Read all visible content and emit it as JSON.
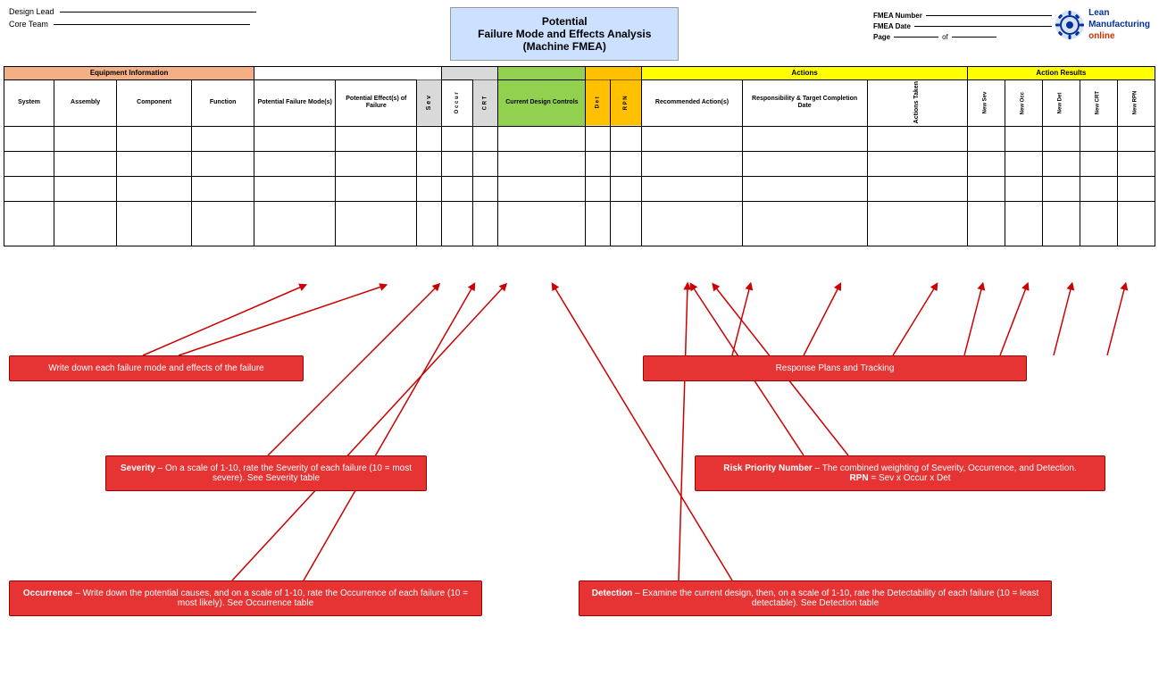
{
  "header": {
    "design_lead_label": "Design Lead",
    "core_team_label": "Core Team",
    "title1": "Potential",
    "title2": "Failure Mode and Effects Analysis",
    "title3": "(Machine FMEA)",
    "fmea_number_label": "FMEA Number",
    "fmea_date_label": "FMEA Date",
    "page_label": "Page",
    "of_label": "of",
    "logo_line1": "Lean",
    "logo_line2": "Manufacturing",
    "logo_line3": "online"
  },
  "table": {
    "equipment_info": "Equipment Information",
    "actions_header": "Actions",
    "action_results_header": "Action Results",
    "cols": {
      "system": "System",
      "assembly": "Assembly",
      "component": "Component",
      "function": "Function",
      "potential_failure_mode": "Potential Failure Mode(s)",
      "potential_effects": "Potential Effect(s) of Failure",
      "sev": "S e v",
      "occ": "O c c u r",
      "crt": "C R T",
      "current_design": "Current Design Controls",
      "det": "D e t",
      "rpn": "R P N",
      "recommended_actions": "Recommended Action(s)",
      "responsibility": "Responsibility & Target Completion Date",
      "actions_taken": "Actions Taken",
      "new_sev": "New Sev",
      "new_occ": "New Occ",
      "new_det": "New Det",
      "new_crt": "New CRT",
      "new_rpn": "New RPN"
    }
  },
  "callouts": {
    "failure": "Write down each failure mode and effects of the failure",
    "severity_bold": "Severity",
    "severity_text": " – On a scale of 1-10, rate the Severity of each failure (10 = most severe). See Severity table",
    "occurrence_bold": "Occurrence",
    "occurrence_text": " – Write down the potential causes, and on a scale of 1-10, rate the Occurrence of each failure (10 = most likely). See Occurrence table",
    "response": "Response Plans and Tracking",
    "rpn_bold": "Risk Priority Number",
    "rpn_text": " – The combined weighting of Severity, Occurrence, and Detection. RPN = Sev x Occur x Det",
    "rpn_bold2": "RPN",
    "rpn_formula": " = Sev x Occur x Det",
    "detection_bold": "Detection",
    "detection_text": " –  Examine the current design, then, on a scale of 1-10, rate the Detectability of each failure (10 = least detectable). See Detection table"
  }
}
